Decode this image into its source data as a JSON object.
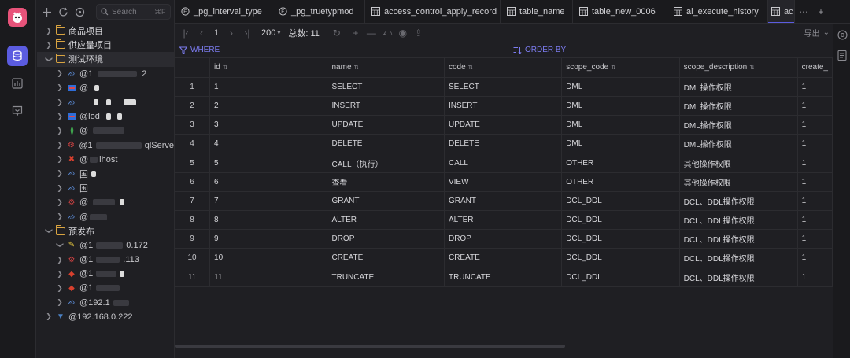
{
  "explorer": {
    "search_placeholder": "Search",
    "search_shortcut": "⌘F",
    "folders": [
      {
        "label": "商品项目",
        "expanded": false
      },
      {
        "label": "供应量项目",
        "expanded": false
      },
      {
        "label": "测试环境",
        "expanded": true
      },
      {
        "label": "预发布",
        "expanded": true
      }
    ],
    "connections": {
      "c1": {
        "prefix": "@1",
        "suffix": "2"
      },
      "c2": {
        "prefix": "@"
      },
      "c3": {
        "prefix": ""
      },
      "c4": {
        "prefix": "@lod"
      },
      "c5": {
        "prefix": "@"
      },
      "c6": {
        "prefix": "@1",
        "suffix": "qlServe"
      },
      "c7": {
        "prefix": "@",
        "suffix": "lhost"
      },
      "c8": {
        "prefix": "国"
      },
      "c9": {
        "prefix": "国"
      },
      "c10": {
        "prefix": "@"
      },
      "c11": {
        "prefix": "@"
      },
      "p1": {
        "prefix": "@1",
        "suffix": "0.172"
      },
      "p2": {
        "prefix": "@1",
        "suffix": ".113"
      },
      "p3": {
        "prefix": "@1"
      },
      "p4": {
        "prefix": "@1"
      },
      "p5": {
        "prefix": "@192.1"
      }
    },
    "last_connection": "@192.168.0.222"
  },
  "tabs": [
    {
      "label": "_pg_interval_type",
      "icon": "function-icon"
    },
    {
      "label": "_pg_truetypmod",
      "icon": "function-icon"
    },
    {
      "label": "access_control_apply_record",
      "icon": "table-icon"
    },
    {
      "label": "table_name",
      "icon": "table-icon"
    },
    {
      "label": "table_new_0006",
      "icon": "table-icon"
    },
    {
      "label": "ai_execute_history",
      "icon": "table-icon"
    },
    {
      "label": "ac",
      "icon": "table-icon"
    }
  ],
  "toolbar": {
    "page": "1",
    "page_size": "200",
    "total": "总数: 11",
    "export": "导出"
  },
  "filter": {
    "where": "WHERE",
    "order_by": "ORDER BY"
  },
  "table": {
    "columns": [
      "id",
      "name",
      "code",
      "scope_code",
      "scope_description",
      "create_"
    ],
    "rows": [
      [
        "1",
        "1",
        "SELECT",
        "SELECT",
        "DML",
        "DML操作权限",
        "1"
      ],
      [
        "2",
        "2",
        "INSERT",
        "INSERT",
        "DML",
        "DML操作权限",
        "1"
      ],
      [
        "3",
        "3",
        "UPDATE",
        "UPDATE",
        "DML",
        "DML操作权限",
        "1"
      ],
      [
        "4",
        "4",
        "DELETE",
        "DELETE",
        "DML",
        "DML操作权限",
        "1"
      ],
      [
        "5",
        "5",
        "CALL（执行）",
        "CALL",
        "OTHER",
        "其他操作权限",
        "1"
      ],
      [
        "6",
        "6",
        "查看",
        "VIEW",
        "OTHER",
        "其他操作权限",
        "1"
      ],
      [
        "7",
        "7",
        "GRANT",
        "GRANT",
        "DCL_DDL",
        "DCL、DDL操作权限",
        "1"
      ],
      [
        "8",
        "8",
        "ALTER",
        "ALTER",
        "DCL_DDL",
        "DCL、DDL操作权限",
        "1"
      ],
      [
        "9",
        "9",
        "DROP",
        "DROP",
        "DCL_DDL",
        "DCL、DDL操作权限",
        "1"
      ],
      [
        "10",
        "10",
        "CREATE",
        "CREATE",
        "DCL_DDL",
        "DCL、DDL操作权限",
        "1"
      ],
      [
        "11",
        "11",
        "TRUNCATE",
        "TRUNCATE",
        "DCL_DDL",
        "DCL、DDL操作权限",
        "1"
      ]
    ]
  },
  "colors": {
    "accent": "#5b5ce0",
    "folder": "#d9a441",
    "logo": "#e8537a"
  }
}
